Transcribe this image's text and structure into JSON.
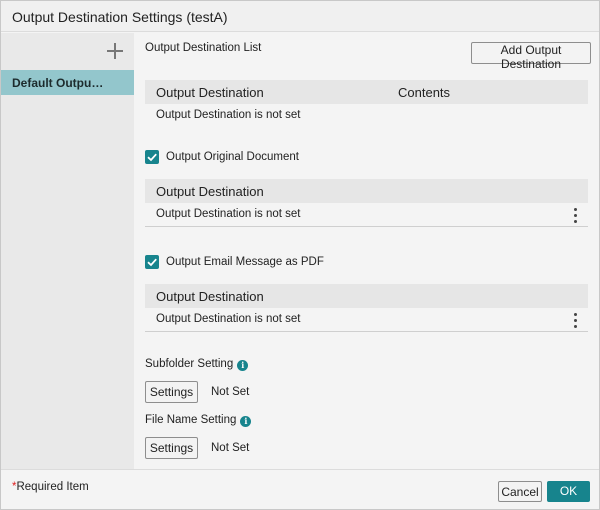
{
  "window": {
    "title": "Output Destination Settings (testA)"
  },
  "sidebar": {
    "items": [
      {
        "label": "Default Outpu…"
      }
    ]
  },
  "main": {
    "list_label": "Output Destination List",
    "add_button_label": "Add Output Destination",
    "list_table": {
      "headers": [
        "Output Destination",
        "Contents"
      ],
      "row": "Output Destination is not set"
    },
    "original": {
      "checkbox_label": "Output Original Document",
      "checked": true,
      "header": "Output Destination",
      "row": "Output Destination is not set"
    },
    "email_pdf": {
      "checkbox_label": "Output Email Message as PDF",
      "checked": true,
      "header": "Output Destination",
      "row": "Output Destination is not set"
    },
    "subfolder": {
      "label": "Subfolder Setting",
      "button": "Settings",
      "value": "Not Set"
    },
    "filename": {
      "label": "File Name Setting",
      "button": "Settings",
      "value": "Not Set"
    }
  },
  "footer": {
    "required_star": "*",
    "required_text": "Required Item",
    "cancel_label": "Cancel",
    "ok_label": "OK"
  },
  "colors": {
    "accent": "#17848d",
    "sidebar_selected": "#93c6cc"
  },
  "icons": {
    "add": "plus-icon",
    "menu": "kebab-icon",
    "info": "info-icon",
    "check": "checkmark-icon"
  }
}
